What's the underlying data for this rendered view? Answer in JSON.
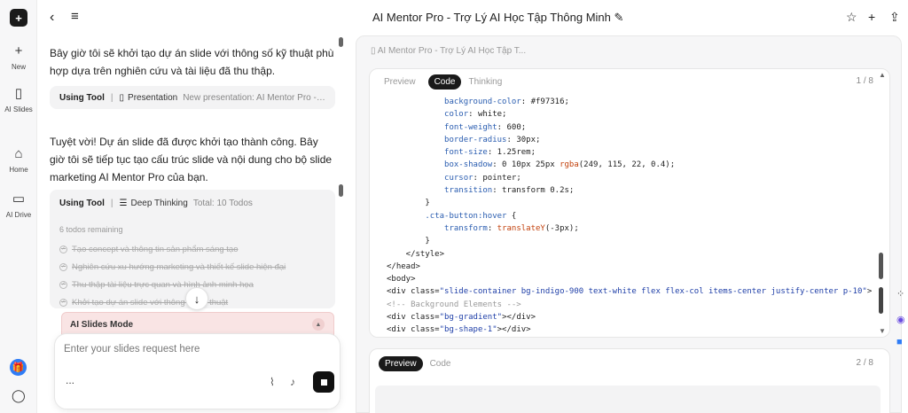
{
  "rail": {
    "logo": "+",
    "items": [
      {
        "icon": "+",
        "label": "New"
      },
      {
        "icon": "▯",
        "label": "AI Slides"
      },
      {
        "icon": "⌂",
        "label": "Home"
      },
      {
        "icon": "▭",
        "label": "AI Drive"
      }
    ]
  },
  "topbar": {
    "title": "AI Mentor Pro - Trợ Lý AI Học Tập Thông Minh ✎"
  },
  "chat": {
    "msg1": "Bây giờ tôi sẽ khởi tạo dự án slide với thông số kỹ thuật phù hợp dựa trên nghiên cứu và tài liệu đã thu thập.",
    "tool1": {
      "label": "Using Tool",
      "name": "Presentation",
      "desc": "New presentation: AI Mentor Pro - Trợ..."
    },
    "msg2": "Tuyệt vời! Dự án slide đã được khởi tạo thành công. Bây giờ tôi sẽ tiếp tục tạo cấu trúc slide và nội dung cho bộ slide marketing AI Mentor Pro của bạn.",
    "tool2": {
      "label": "Using Tool",
      "name": "Deep Thinking",
      "desc": "Total: 10 Todos"
    },
    "remaining": "6 todos remaining",
    "todos": [
      "Tạo concept và thông tin sản phẩm sáng tạo",
      "Nghiên cứu xu hướng marketing và thiết kế slide hiện đại",
      "Thu thập tài liệu trực quan và hình ảnh minh họa",
      "Khởi tạo dự án slide với thông số kỹ thuật"
    ],
    "mode_label": "AI Slides Mode",
    "input_placeholder": "Enter your slides request here",
    "more": "..."
  },
  "panel": {
    "title": "AI Mentor Pro - Trợ Lý AI Học Tập T...",
    "tabs": [
      "Preview",
      "Code",
      "Thinking"
    ],
    "page1": "1 / 8",
    "tabs2": [
      "Preview",
      "Code"
    ],
    "page2": "2 / 8",
    "code_lines": [
      "            background-color: #f97316;",
      "            color: white;",
      "            font-weight: 600;",
      "            border-radius: 30px;",
      "            font-size: 1.25rem;",
      "            box-shadow: 0 10px 25px rgba(249, 115, 22, 0.4);",
      "            cursor: pointer;",
      "            transition: transform 0.2s;",
      "        }",
      "        .cta-button:hover {",
      "            transform: translateY(-3px);",
      "        }",
      "    </style>",
      "</head>",
      "<body>",
      "<div class=\"slide-container bg-indigo-900 text-white flex flex-col items-center justify-center p-10\">",
      "<!-- Background Elements -->",
      "<div class=\"bg-gradient\"></div>",
      "<div class=\"bg-shape-1\"></div>",
      "<div class=\"bg-shape-2\"></div>"
    ]
  },
  "colors": {
    "accent": "#2f7cf6",
    "mode_bg": "#f9e4e4",
    "dark": "#1a1a1a"
  }
}
